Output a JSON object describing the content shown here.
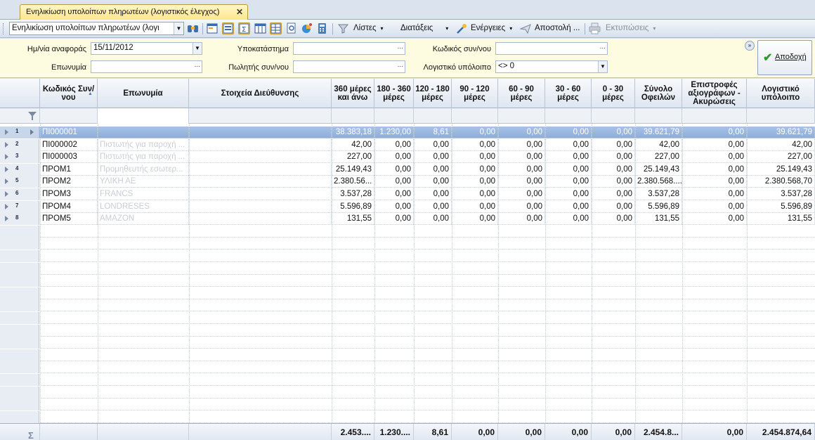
{
  "tab": {
    "title": "Ενηλικίωση υπολοίπων πληρωτέων (λογιστικός έλεγχος)",
    "close": "✕"
  },
  "toolbar": {
    "view_combo": "Ενηλικίωση υπολοίπων πληρωτέων (λογι",
    "lists_label": "Λίστες",
    "settings_label": "Διατάξεις",
    "actions_label": "Ενέργειες",
    "send_label": "Αποστολή ...",
    "print_label": "Εκτυπώσεις",
    "dropdown_glyph": "▾"
  },
  "filters": {
    "date_label": "Ημ/νία αναφοράς",
    "date_value": "15/11/2012",
    "branch_label": "Υποκατάστημα",
    "branch_value": "",
    "code_label": "Κωδικός συν/νου",
    "code_value": "",
    "name_label": "Επωνυμία",
    "name_value": "",
    "seller_label": "Πωλητής συν/νου",
    "seller_value": "",
    "balance_label": "Λογιστικό υπόλοιπο",
    "balance_value": "<> 0",
    "dots": "...",
    "accept_label": "Αποδοχή"
  },
  "grid": {
    "columns": [
      "Κωδικός Συν/νου",
      "Επωνυμία",
      "Στοιχεία Διεύθυνσης",
      "360 μέρες και άνω",
      "180 - 360 μέρες",
      "120 - 180 μέρες",
      "90 - 120 μέρες",
      "60 - 90 μέρες",
      "30 - 60 μέρες",
      "0 - 30 μέρες",
      "Σύνολο Οφειλών",
      "Επιστροφές αξιογράφων - Ακυρώσεις",
      "Λογιστικό υπόλοιπο"
    ],
    "rows": [
      {
        "n": "1",
        "code": "ΠΙ000001",
        "name": "",
        "addr": "",
        "c360": "38.383,18",
        "c180": "1.230,00",
        "c120": "8,61",
        "c90": "0,00",
        "c60": "0,00",
        "c30": "0,00",
        "c0": "0,00",
        "total": "39.621,79",
        "ret": "0,00",
        "bal": "39.621,79"
      },
      {
        "n": "2",
        "code": "ΠΙ000002",
        "name": "Πιστωτής για παροχή ...",
        "addr": "",
        "c360": "42,00",
        "c180": "0,00",
        "c120": "0,00",
        "c90": "0,00",
        "c60": "0,00",
        "c30": "0,00",
        "c0": "0,00",
        "total": "42,00",
        "ret": "0,00",
        "bal": "42,00"
      },
      {
        "n": "3",
        "code": "ΠΙ000003",
        "name": "Πιστωτής για παροχή ...",
        "addr": "",
        "c360": "227,00",
        "c180": "0,00",
        "c120": "0,00",
        "c90": "0,00",
        "c60": "0,00",
        "c30": "0,00",
        "c0": "0,00",
        "total": "227,00",
        "ret": "0,00",
        "bal": "227,00"
      },
      {
        "n": "4",
        "code": "ΠΡΟΜ1",
        "name": "Προμηθευτής εσωτερ...",
        "addr": "",
        "c360": "25.149,43",
        "c180": "0,00",
        "c120": "0,00",
        "c90": "0,00",
        "c60": "0,00",
        "c30": "0,00",
        "c0": "0,00",
        "total": "25.149,43",
        "ret": "0,00",
        "bal": "25.149,43"
      },
      {
        "n": "5",
        "code": "ΠΡΟΜ2",
        "name": "ΥΛΙΚΗ ΑΕ",
        "addr": "",
        "c360": "2.380.56...",
        "c180": "0,00",
        "c120": "0,00",
        "c90": "0,00",
        "c60": "0,00",
        "c30": "0,00",
        "c0": "0,00",
        "total": "2.380.568....",
        "ret": "0,00",
        "bal": "2.380.568,70"
      },
      {
        "n": "6",
        "code": "ΠΡΟΜ3",
        "name": "FRANCS",
        "addr": "",
        "c360": "3.537,28",
        "c180": "0,00",
        "c120": "0,00",
        "c90": "0,00",
        "c60": "0,00",
        "c30": "0,00",
        "c0": "0,00",
        "total": "3.537,28",
        "ret": "0,00",
        "bal": "3.537,28"
      },
      {
        "n": "7",
        "code": "ΠΡΟΜ4",
        "name": "LONDRESES",
        "addr": "",
        "c360": "5.596,89",
        "c180": "0,00",
        "c120": "0,00",
        "c90": "0,00",
        "c60": "0,00",
        "c30": "0,00",
        "c0": "0,00",
        "total": "5.596,89",
        "ret": "0,00",
        "bal": "5.596,89"
      },
      {
        "n": "8",
        "code": "ΠΡΟΜ5",
        "name": "AMAZON",
        "addr": "",
        "c360": "131,55",
        "c180": "0,00",
        "c120": "0,00",
        "c90": "0,00",
        "c60": "0,00",
        "c30": "0,00",
        "c0": "0,00",
        "total": "131,55",
        "ret": "0,00",
        "bal": "131,55"
      }
    ],
    "totals": {
      "sigma": "Σ",
      "c360": "2.453....",
      "c180": "1.230....",
      "c120": "8,61",
      "c90": "0,00",
      "c60": "0,00",
      "c30": "0,00",
      "c0": "0,00",
      "total": "2.454.8...",
      "ret": "0,00",
      "bal": "2.454.874,64"
    }
  },
  "colors": {
    "accent": "#ffe58a",
    "selected_row": "#9bb6de",
    "filter_bg": "#fdfbe0"
  }
}
